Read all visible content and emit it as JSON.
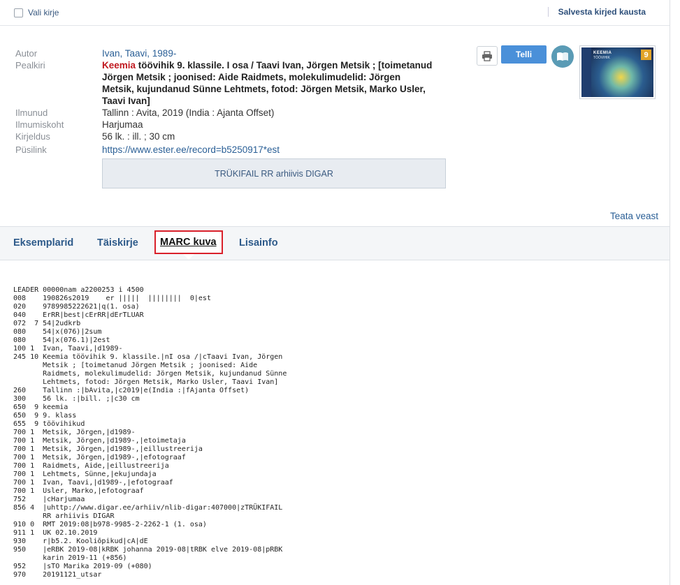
{
  "topbar": {
    "select_all_label": "Vali kirje",
    "save_label": "Salvesta kirjed kausta"
  },
  "record": {
    "fields": {
      "author": {
        "label": "Autor",
        "value": "Ivan, Taavi, 1989-"
      },
      "title": {
        "label": "Pealkiri",
        "highlight": "Keemia",
        "rest_line1": " töövihik 9. klassile. I osa / Taavi Ivan, Jörgen Metsik ; [toimetanud",
        "line2": "Jörgen Metsik ; joonised: Aide Raidmets, molekulimudelid: Jörgen",
        "line3": "Metsik, kujundanud Sünne Lehtmets, fotod: Jörgen Metsik, Marko Usler,",
        "line4": "Taavi Ivan]"
      },
      "published": {
        "label": "Ilmunud",
        "value": "Tallinn : Avita, 2019 (India : Ajanta Offset)"
      },
      "place": {
        "label": "Ilmumiskoht",
        "value": "Harjumaa"
      },
      "description": {
        "label": "Kirjeldus",
        "value": "56 lk. : ill. ; 30 cm"
      },
      "permalink": {
        "label": "Püsilink",
        "value": "https://www.ester.ee/record=b5250917*est"
      }
    },
    "digar_button": "TRÜKIFAIL RR arhiivis DIGAR",
    "order_button": "Telli",
    "cover": {
      "title": "KEEMIA",
      "subtitle": "TÖÖVIHIK",
      "number": "9"
    },
    "report_error": "Teata veast"
  },
  "tabs": [
    {
      "label": "Eksemplarid"
    },
    {
      "label": "Täiskirje"
    },
    {
      "label": "MARC kuva"
    },
    {
      "label": "Lisainfo"
    }
  ],
  "marc_lines": [
    "LEADER 00000nam a2200253 i 4500",
    "008    190826s2019    er |||||  ||||||||  0|est",
    "020    9789985222621|q(1. osa)",
    "040    ErRR|best|cErRR|dErTLUAR",
    "072  7 54|2udkrb",
    "080    54|x(076)|2sum",
    "080    54|x(076.1)|2est",
    "100 1  Ivan, Taavi,|d1989-",
    "245 10 Keemia töövihik 9. klassile.|nI osa /|cTaavi Ivan, Jörgen",
    "       Metsik ; [toimetanud Jörgen Metsik ; joonised: Aide",
    "       Raidmets, molekulimudelid: Jörgen Metsik, kujundanud Sünne",
    "       Lehtmets, fotod: Jörgen Metsik, Marko Usler, Taavi Ivan]",
    "260    Tallinn :|bAvita,|c2019|e(India :|fAjanta Offset)",
    "300    56 lk. :|bill. ;|c30 cm",
    "650  9 keemia",
    "650  9 9. klass",
    "655  9 töövihikud",
    "700 1  Metsik, Jörgen,|d1989-",
    "700 1  Metsik, Jörgen,|d1989-,|etoimetaja",
    "700 1  Metsik, Jörgen,|d1989-,|eillustreerija",
    "700 1  Metsik, Jörgen,|d1989-,|efotograaf",
    "700 1  Raidmets, Aide,|eillustreerija",
    "700 1  Lehtmets, Sünne,|ekujundaja",
    "700 1  Ivan, Taavi,|d1989-,|efotograaf",
    "700 1  Usler, Marko,|efotograaf",
    "752    |cHarjumaa",
    "856 4  |uhttp://www.digar.ee/arhiiv/nlib-digar:407000|zTRÜKIFAIL",
    "       RR arhiivis DIGAR",
    "910 0  RMT 2019:08|b978-9985-2-2262-1 (1. osa)",
    "911 1  UK 02.10.2019",
    "930    r|b5.2. Kooliõpikud|cA|dE",
    "950    |eRBK 2019-08|kRBK johanna 2019-08|tRBK elve 2019-08|pRBK",
    "       karin 2019-11 (+856)",
    "952    |sTO Marika 2019-09 (+080)",
    "970    20191121_utsar"
  ]
}
